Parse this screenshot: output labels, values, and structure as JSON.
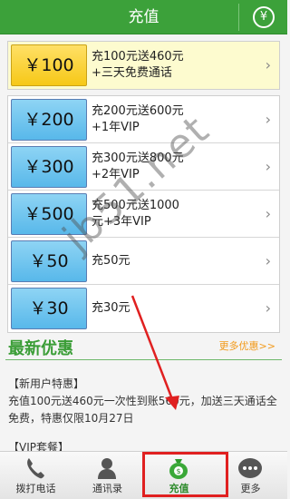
{
  "header": {
    "title": "充值",
    "currency_icon": "yen-circle-icon",
    "currency_symbol": "¥"
  },
  "featured": {
    "price": "￥100",
    "line1": "充100元送460元",
    "line2": "+三天免费通话"
  },
  "packages": [
    {
      "price": "￥200",
      "line1": "充200元送600元",
      "line2": "+1年VIP"
    },
    {
      "price": "￥300",
      "line1": "充300元送800元",
      "line2": "+2年VIP"
    },
    {
      "price": "￥500",
      "line1": "充500元送1000",
      "line2": "元+3年VIP"
    },
    {
      "price": "￥50",
      "line1": "充50元",
      "line2": ""
    },
    {
      "price": "￥30",
      "line1": "充30元",
      "line2": ""
    }
  ],
  "chevron": "›",
  "section": {
    "title": "最新优惠",
    "more": "更多优惠>>"
  },
  "promos": {
    "new_user_tag": "【新用户特惠】",
    "new_user_body": "充值100元送460元一次性到账560元，加送三天通话全免费，特惠仅限10月27日",
    "vip_tag": "【VIP套餐】"
  },
  "tabs": [
    {
      "label": "拨打电话",
      "icon": "phone-icon"
    },
    {
      "label": "通讯录",
      "icon": "contacts-icon"
    },
    {
      "label": "充值",
      "icon": "money-bag-icon",
      "active": true
    },
    {
      "label": "更多",
      "icon": "more-icon"
    }
  ],
  "watermark": "jb51.net",
  "colors": {
    "brand_green": "#3ca13a",
    "featured_yellow": "#f6c817",
    "price_blue": "#58b8ea",
    "more_orange": "#f29a1b",
    "annotation_red": "#e02020"
  }
}
